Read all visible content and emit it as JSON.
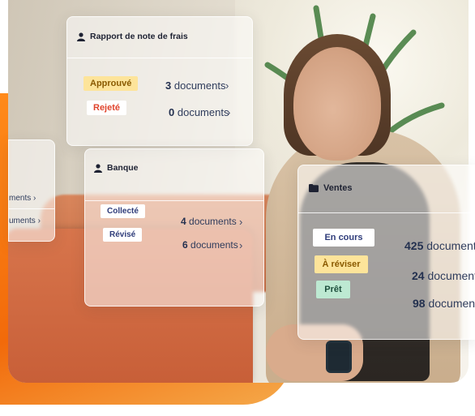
{
  "notes_card": {
    "title": "Rapport de note de frais",
    "rows": [
      {
        "badge": "Approuvé",
        "count": "3",
        "unit": "documents"
      },
      {
        "badge": "Rejeté",
        "count": "0",
        "unit": "documents"
      }
    ]
  },
  "left_card": {
    "rows": [
      {
        "text": "ments"
      },
      {
        "text": "uments"
      }
    ]
  },
  "bank_card": {
    "title": "Banque",
    "rows": [
      {
        "badge": "Collecté",
        "count": "4",
        "unit": "documents"
      },
      {
        "badge": "Révisé",
        "count": "6",
        "unit": "documents"
      }
    ]
  },
  "sales_card": {
    "title": "Ventes",
    "rows": [
      {
        "badge": "En cours",
        "count": "425",
        "unit": "documents"
      },
      {
        "badge": "À réviser",
        "count": "24",
        "unit": "documents"
      },
      {
        "badge": "Prêt",
        "count": "98",
        "unit": "documents"
      }
    ]
  },
  "colors": {
    "accent_orange": "#f26a0a",
    "badge_yellow": "#fde49a",
    "badge_green": "#bde9d2",
    "badge_white": "#ffffff",
    "text_navy": "#23304f"
  }
}
